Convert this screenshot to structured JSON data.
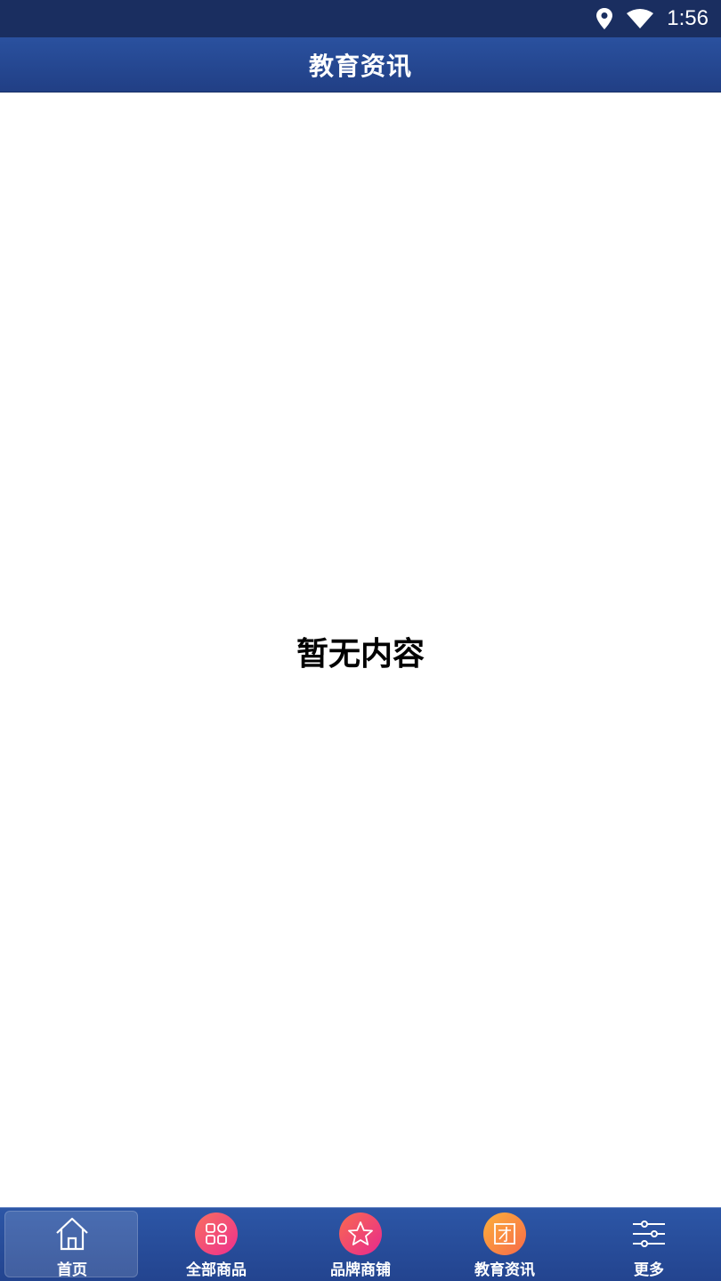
{
  "status_bar": {
    "time": "1:56",
    "icons": [
      "location-icon",
      "wifi-icon"
    ]
  },
  "header": {
    "title": "教育资讯"
  },
  "main": {
    "empty_message": "暂无内容"
  },
  "tabbar": {
    "items": [
      {
        "label": "首页",
        "icon": "home-icon",
        "active": true
      },
      {
        "label": "全部商品",
        "icon": "grid-icon",
        "color": "#f5407a"
      },
      {
        "label": "品牌商铺",
        "icon": "star-icon",
        "color": "#f0436a"
      },
      {
        "label": "教育资讯",
        "icon": "tuan-icon",
        "color": "#f98a3a"
      },
      {
        "label": "更多",
        "icon": "sliders-icon"
      }
    ]
  },
  "colors": {
    "header_bg": "#2a519f",
    "status_bg": "#1a2e60",
    "tabbar_bg": "#2c56a6"
  }
}
